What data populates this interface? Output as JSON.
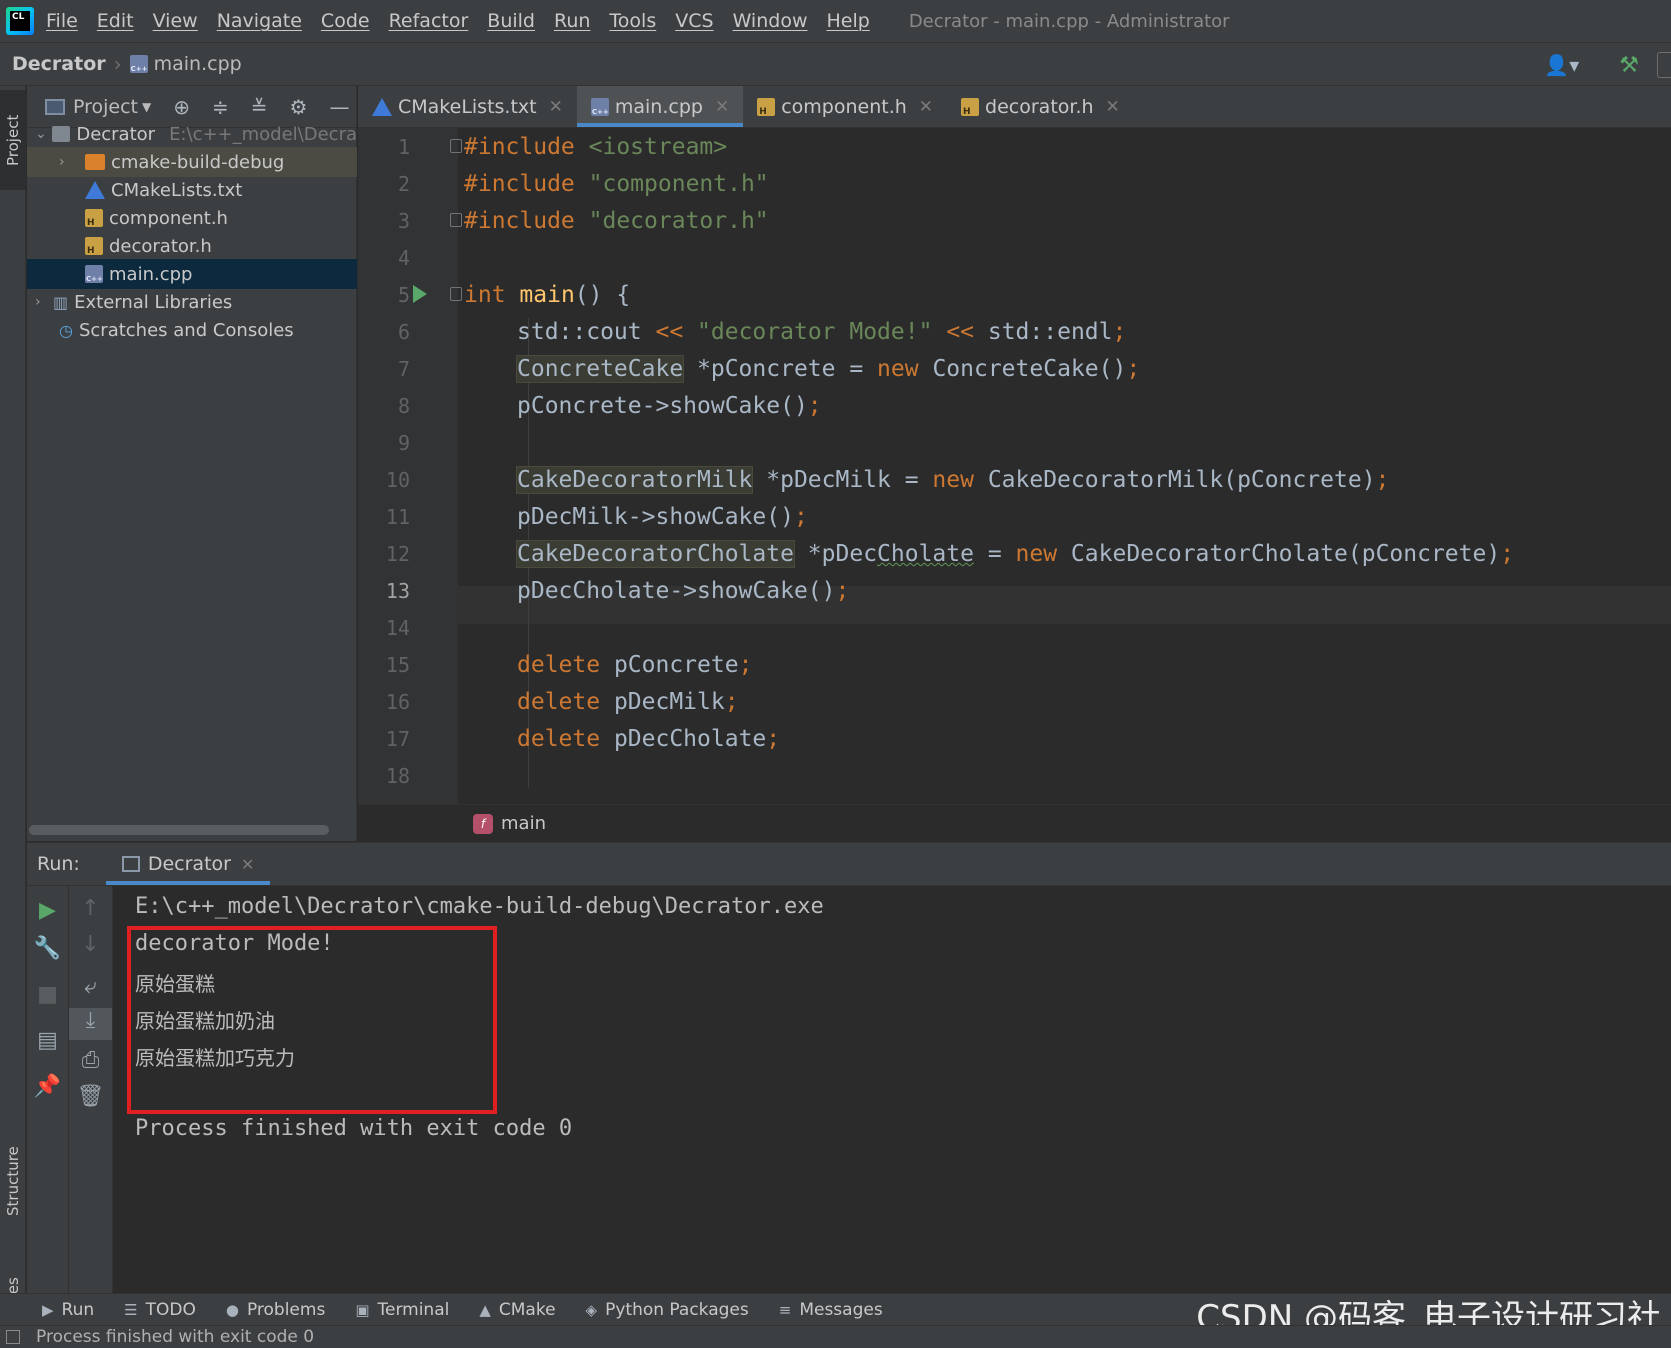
{
  "menubar": {
    "items": [
      "File",
      "Edit",
      "View",
      "Navigate",
      "Code",
      "Refactor",
      "Build",
      "Run",
      "Tools",
      "VCS",
      "Window",
      "Help"
    ],
    "window_title": "Decrator - main.cpp - Administrator",
    "logo_text": "CL"
  },
  "navbar": {
    "project": "Decrator",
    "file": "main.cpp"
  },
  "sidebar_tabs": {
    "project": "Project",
    "structure": "Structure",
    "favorites": "Favorites"
  },
  "project_panel": {
    "title": "Project",
    "tree": [
      {
        "label": "Decrator",
        "path": "E:\\c++_model\\Decra",
        "kind": "folder-root"
      },
      {
        "label": "cmake-build-debug",
        "kind": "folder"
      },
      {
        "label": "CMakeLists.txt",
        "kind": "cmake"
      },
      {
        "label": "component.h",
        "kind": "header"
      },
      {
        "label": "decorator.h",
        "kind": "header"
      },
      {
        "label": "main.cpp",
        "kind": "cpp"
      },
      {
        "label": "External Libraries",
        "kind": "libraries"
      },
      {
        "label": "Scratches and Consoles",
        "kind": "scratches"
      }
    ]
  },
  "editor_tabs": [
    {
      "label": "CMakeLists.txt",
      "icon": "cmake-icon",
      "active": false
    },
    {
      "label": "main.cpp",
      "icon": "cpp-file-icon",
      "active": true
    },
    {
      "label": "component.h",
      "icon": "header-file-icon",
      "active": false
    },
    {
      "label": "decorator.h",
      "icon": "header-file-icon",
      "active": false
    }
  ],
  "editor": {
    "current_line": 13,
    "line_numbers": [
      "1",
      "2",
      "3",
      "4",
      "5",
      "6",
      "7",
      "8",
      "9",
      "10",
      "11",
      "12",
      "13",
      "14",
      "15",
      "16",
      "17",
      "18"
    ],
    "code": {
      "l1": {
        "kw": "#include",
        "str": "<iostream>"
      },
      "l2": {
        "kw": "#include",
        "str": "\"component.h\""
      },
      "l3": {
        "kw": "#include",
        "str": "\"decorator.h\""
      },
      "l5": {
        "kw": "int",
        "fn": "main",
        "rest": "() {"
      },
      "l6": {
        "a": "std::cout ",
        "op1": "<<",
        "str": "\"decorator Mode!\"",
        "op2": "<<",
        "b": " std::endl",
        "semi": ";"
      },
      "l7": {
        "cls": "ConcreteCake",
        "a": " *pConcrete = ",
        "kw": "new",
        "b": " ConcreteCake()",
        "semi": ";"
      },
      "l8": {
        "a": "pConcrete->showCake()",
        "semi": ";"
      },
      "l10": {
        "cls": "CakeDecoratorMilk",
        "a": " *pDecMilk = ",
        "kw": "new",
        "b": " CakeDecoratorMilk(pConcrete)",
        "semi": ";"
      },
      "l11": {
        "a": "pDecMilk->showCake()",
        "semi": ";"
      },
      "l12": {
        "cls": "CakeDecoratorCholate",
        "a": " *pDec",
        "typo": "Cholate",
        "eq": " = ",
        "kw": "new",
        "b": " CakeDecoratorCholate(pConcrete)",
        "semi": ";"
      },
      "l13": {
        "a": "pDecCholate->showCake()",
        "semi": ";"
      },
      "l15": {
        "kw": "delete",
        "a": " pConcrete",
        "semi": ";"
      },
      "l16": {
        "kw": "delete",
        "a": " pDecMilk",
        "semi": ";"
      },
      "l17": {
        "kw": "delete",
        "a": " pDecCholate",
        "semi": ";"
      }
    },
    "breadcrumb_function": "main",
    "breadcrumb_badge": "f"
  },
  "run_panel": {
    "label": "Run:",
    "tab": "Decrator",
    "output": [
      "E:\\c++_model\\Decrator\\cmake-build-debug\\Decrator.exe",
      "decorator Mode!",
      "原始蛋糕",
      "原始蛋糕加奶油",
      "原始蛋糕加巧克力",
      "",
      "Process finished with exit code 0"
    ],
    "highlight_color": "#e02020"
  },
  "bottom_tools": [
    "Run",
    "TODO",
    "Problems",
    "Terminal",
    "CMake",
    "Python Packages",
    "Messages"
  ],
  "watermark": "CSDN @码客_电子设计研习社",
  "status": "Process finished with exit code 0",
  "colors": {
    "keyword": "#cc7832",
    "string": "#6a8759",
    "function": "#ffc66d",
    "identifier": "#a9b7c6",
    "accent": "#4a88c7",
    "run_green": "#59a869"
  }
}
